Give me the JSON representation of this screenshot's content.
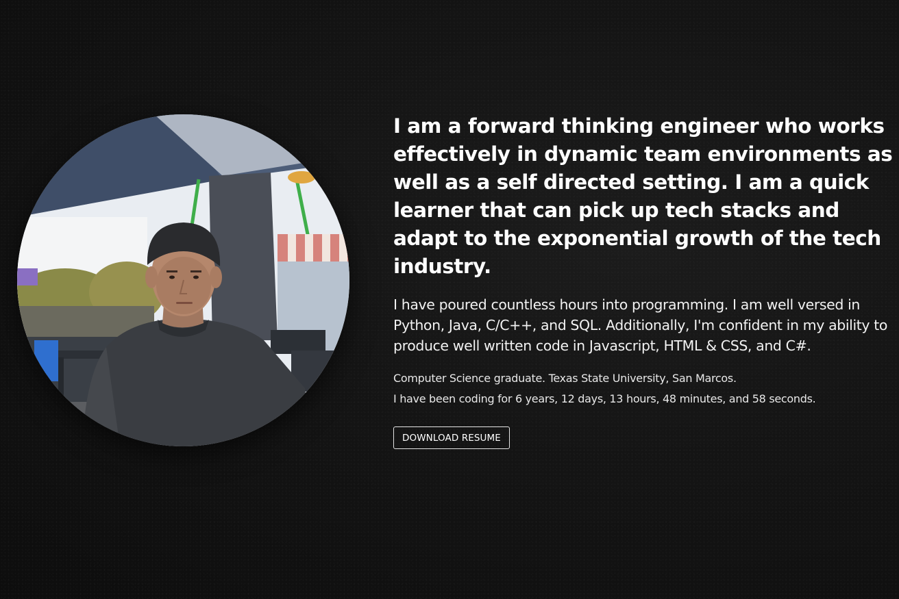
{
  "about": {
    "headline": "I am a forward thinking engineer who works effectively in dynamic team environments as well as a self directed setting. I am a quick learner that can pick up tech stacks and adapt to the exponential growth of the tech industry.",
    "skills": "I have poured countless hours into programming. I am well versed in Python, Java, C/C++, and SQL. Additionally, I'm confident in my ability to produce well written code in Javascript, HTML & CSS, and C#.",
    "education": "Computer Science graduate. Texas State University, San Marcos.",
    "coding_duration": "I have been coding for 6 years, 12 days, 13 hours, 48 minutes, and 58 seconds.",
    "resume_button_label": "DOWNLOAD RESUME"
  },
  "colors": {
    "background": "#141414",
    "text": "#ffffff",
    "button_border": "#e6e6e6"
  }
}
